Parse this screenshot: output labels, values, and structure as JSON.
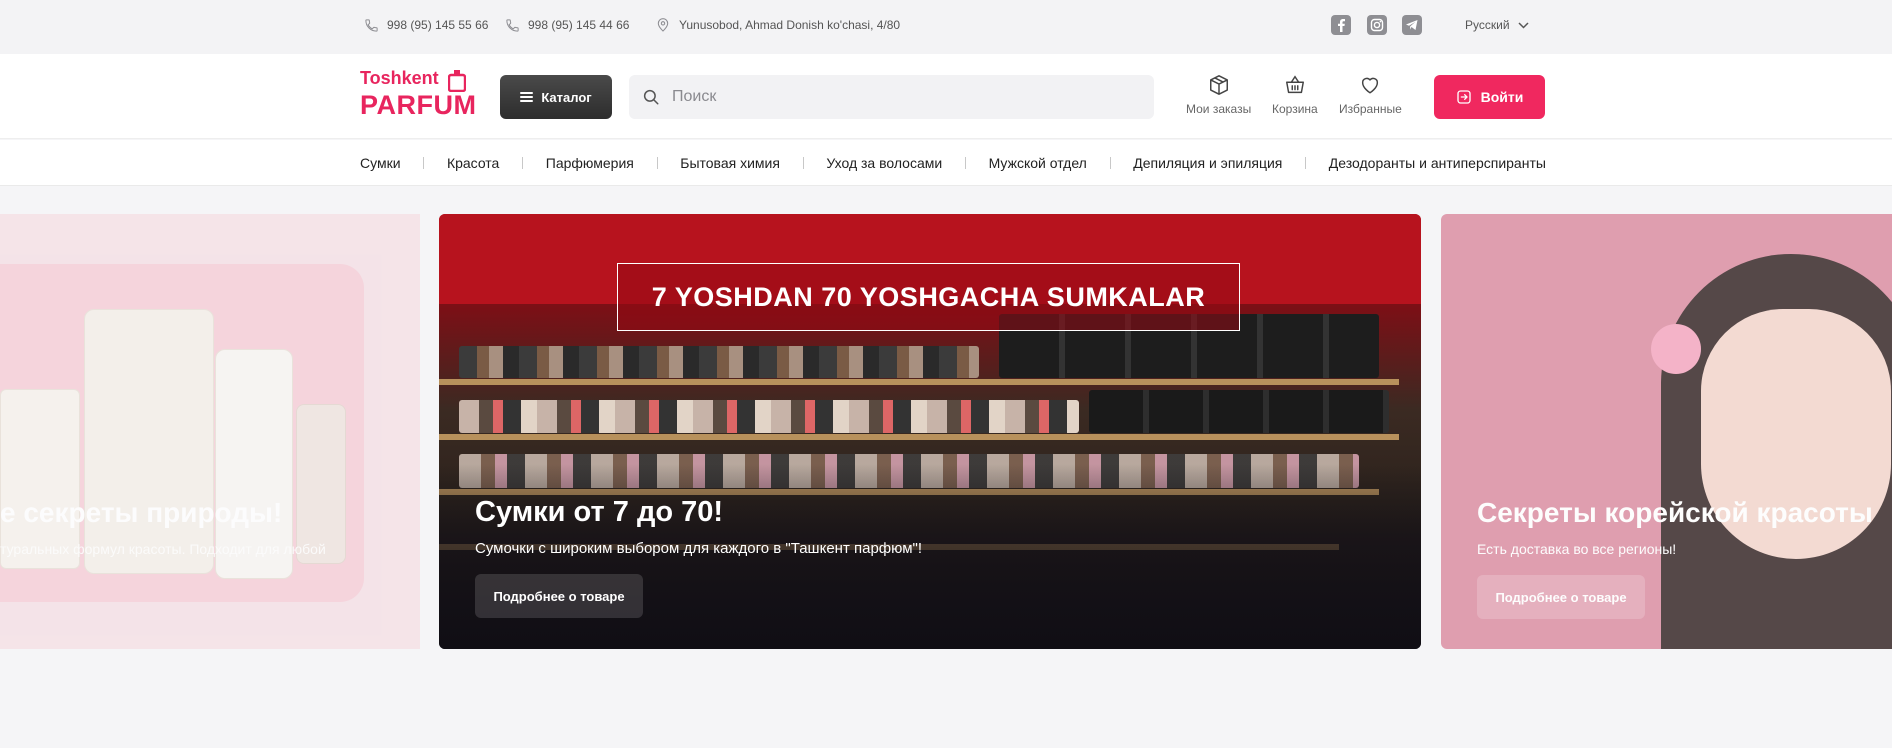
{
  "topbar": {
    "phone1": "998 (95) 145 55 66",
    "phone2": "998 (95) 145 44 66",
    "address": "Yunusobod, Ahmad Donish ko'chasi, 4/80",
    "social": [
      "facebook-icon",
      "instagram-icon",
      "telegram-icon"
    ],
    "language": "Русский"
  },
  "header": {
    "logo_top": "Toshkent",
    "logo_bottom": "PARFUM",
    "catalog_label": "Каталог",
    "search_placeholder": "Поиск",
    "orders_label": "Мои заказы",
    "cart_label": "Корзина",
    "favorites_label": "Избранные",
    "login_label": "Войти"
  },
  "nav": {
    "items": [
      "Сумки",
      "Красота",
      "Парфюмерия",
      "Бытовая химия",
      "Уход за волосами",
      "Мужской отдел",
      "Депиляция и эпиляция",
      "Дезодоранты и антиперспиранты"
    ]
  },
  "banners": {
    "left": {
      "title": "е секреты природы!",
      "subtitle": "туральных формул красоты. Подходит для любой"
    },
    "main": {
      "promo": "7 YOSHDAN 70 YOSHGACHA SUMKALAR",
      "title": "Сумки от 7 до 70!",
      "subtitle": "Сумочки с широким выбором для каждого в \"Ташкент парфюм\"!",
      "button": "Подробнее о товаре"
    },
    "right": {
      "title": "Секреты корейской красоты",
      "subtitle": "Есть доставка во все регионы!",
      "button": "Подробнее о товаре"
    }
  },
  "colors": {
    "brand": "#f0285f",
    "dark_button": "#3a3a3a"
  }
}
